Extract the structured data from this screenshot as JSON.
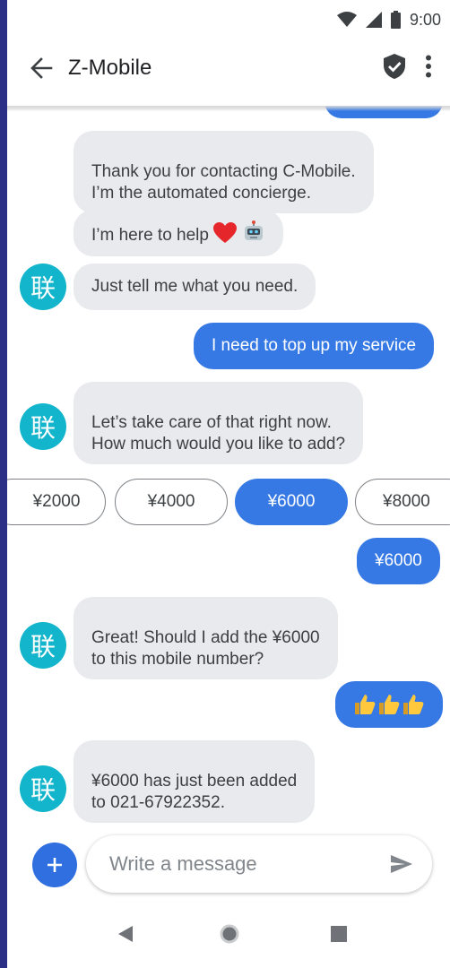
{
  "status_bar": {
    "time": "9:00",
    "icons": [
      "wifi-icon",
      "signal-icon",
      "battery-icon"
    ]
  },
  "app_bar": {
    "title": "Z-Mobile",
    "icons": [
      "back-arrow-icon",
      "verified-shield-icon",
      "more-vert-icon"
    ]
  },
  "messages": [
    {
      "sender": "user",
      "text": ""
    },
    {
      "sender": "bot",
      "text": "Thank you for contacting C-Mobile.\nI’m the automated concierge."
    },
    {
      "sender": "bot",
      "text": "I’m here to help",
      "emojis": [
        "red-heart-icon",
        "robot-icon"
      ]
    },
    {
      "sender": "bot",
      "text": "Just tell me what you need.",
      "avatar": "联"
    },
    {
      "sender": "user",
      "text": "I need to top up my service"
    },
    {
      "sender": "bot",
      "text": "Let’s take care of that right now.\nHow much would you like to add?",
      "avatar": "联"
    },
    {
      "sender": "user",
      "text": "¥6000"
    },
    {
      "sender": "bot",
      "text": "Great! Should I add the ¥6000\nto this mobile number?",
      "avatar": "联"
    },
    {
      "sender": "user",
      "emojis": [
        "thumbs-up-icon",
        "thumbs-up-icon",
        "thumbs-up-icon"
      ]
    },
    {
      "sender": "bot",
      "text": "¥6000 has just been added\nto 021-67922352.",
      "avatar": "联"
    }
  ],
  "suggestion_chips": {
    "options": [
      "¥2000",
      "¥4000",
      "¥6000",
      "¥8000"
    ],
    "selected": "¥6000"
  },
  "composer": {
    "placeholder": "Write a message",
    "icons": [
      "add-icon",
      "send-icon"
    ]
  },
  "nav_bar": {
    "icons": [
      "back-triangle-icon",
      "home-circle-icon",
      "recents-square-icon"
    ]
  },
  "colors": {
    "accent": "#3679e4",
    "avatar": "#12b5cb",
    "incoming_bubble": "#e8eaed",
    "side_strip": "#2b2f86"
  }
}
